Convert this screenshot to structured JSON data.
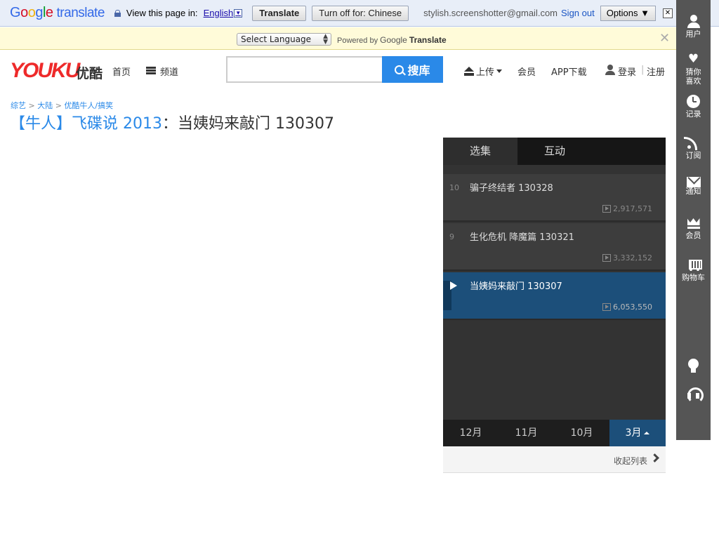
{
  "translate_bar": {
    "logo_google": [
      "G",
      "o",
      "o",
      "g",
      "l",
      "e"
    ],
    "logo_translate": "translate",
    "view_label": "View this page in:",
    "language": "English",
    "translate_btn": "Translate",
    "turn_off_btn": "Turn off for: Chinese",
    "email": "stylish.screenshotter@gmail.com",
    "sign_out": "Sign out",
    "options": "Options ▼",
    "close": "✕"
  },
  "language_strip": {
    "select_value": "Select Language",
    "powered_by": "Powered by",
    "google": "Google",
    "translate": "Translate",
    "close": "✕"
  },
  "header": {
    "logo": "YOUKU",
    "logo_cn": "优酷",
    "home": "首页",
    "channels": "频道",
    "search_placeholder": "",
    "search_btn": "搜库",
    "upload": "上传",
    "vip": "会员",
    "app": "APP下载",
    "login": "登录",
    "separator": "|",
    "register": "注册"
  },
  "breadcrumb": {
    "items": [
      "综艺",
      "大陆",
      "优酷牛人/搞笑"
    ],
    "sep": ">"
  },
  "title": {
    "prefix": "【牛人】飞碟说 2013",
    "colon": "：",
    "main": "当姨妈来敲门 130307"
  },
  "playlist": {
    "tabs": [
      "选集",
      "互动"
    ],
    "episodes": [
      {
        "num": "10",
        "title": "骗子终结者 130328",
        "views": "2,917,571",
        "current": false
      },
      {
        "num": "9",
        "title": "生化危机 降魔篇 130321",
        "views": "3,332,152",
        "current": false
      },
      {
        "num": "",
        "title": "当姨妈来敲门 130307",
        "views": "6,053,550",
        "current": true
      }
    ],
    "months": [
      "12月",
      "11月",
      "10月",
      "3月"
    ],
    "active_month": "3月",
    "collapse": "收起列表"
  },
  "sidebar": {
    "items": [
      {
        "label": "用户",
        "icon": "user-icon"
      },
      {
        "label": "猜你\n喜欢",
        "icon": "heart-icon"
      },
      {
        "label": "记录",
        "icon": "clock-icon"
      },
      {
        "label": "订阅",
        "icon": "rss-icon"
      },
      {
        "label": "通知",
        "icon": "mail-icon"
      },
      {
        "label": "会员",
        "icon": "crown-icon"
      },
      {
        "label": "购物车",
        "icon": "cart-icon"
      }
    ]
  },
  "colors": {
    "accent": "#2a89e8",
    "youku_red": "#ee2a2a",
    "panel_bg": "#333333",
    "current_bg": "#1c4f7a"
  }
}
